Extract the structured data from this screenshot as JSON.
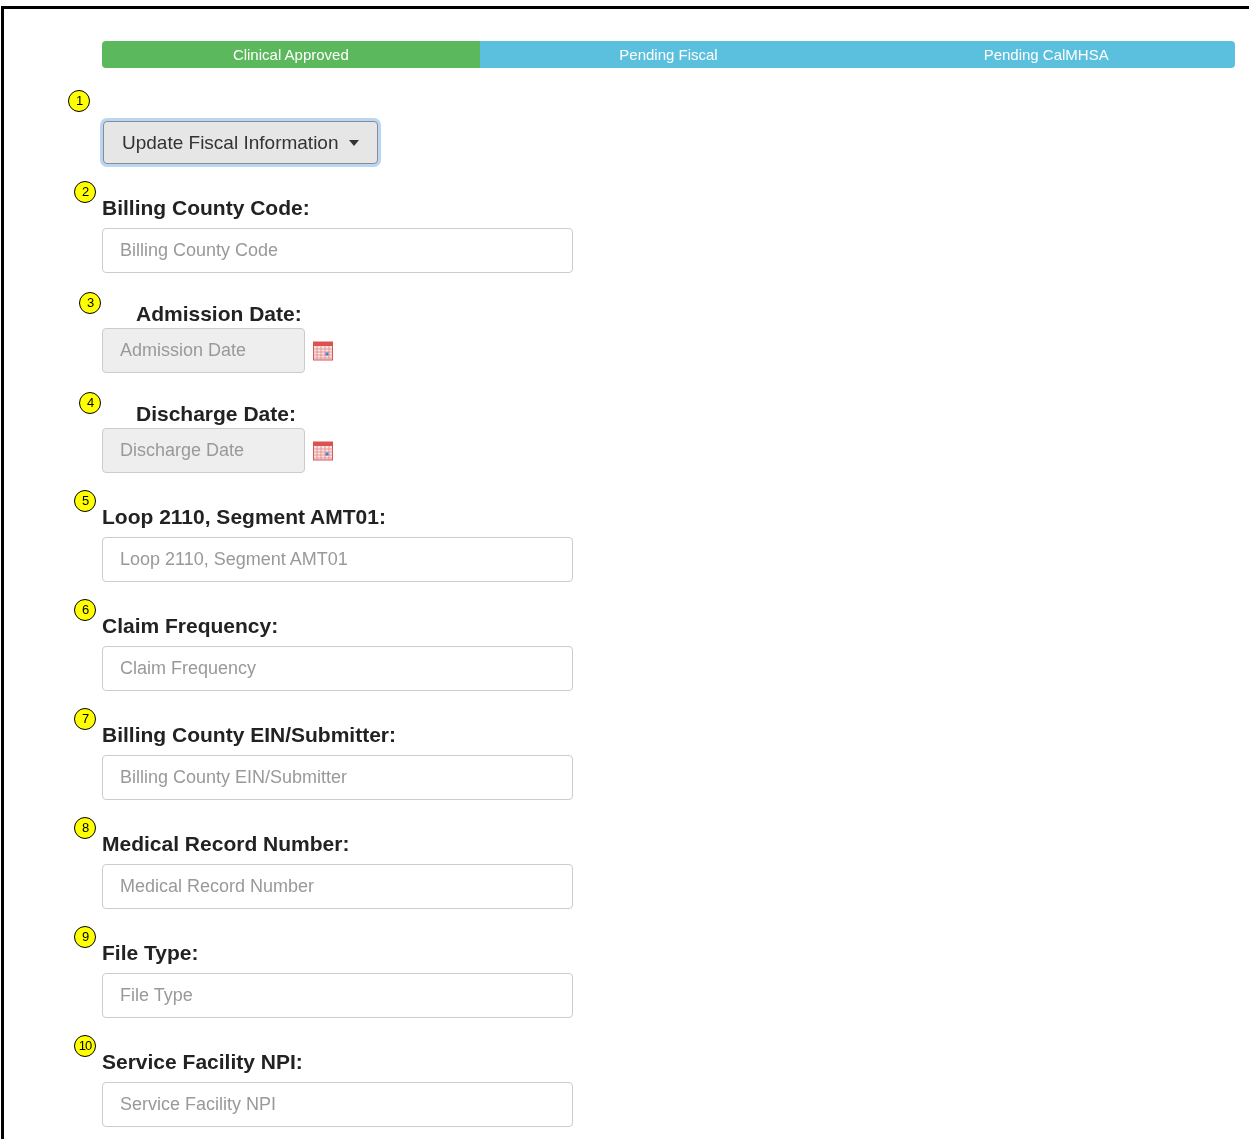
{
  "status_steps": [
    {
      "label": "Clinical Approved",
      "color": "#5cb85c"
    },
    {
      "label": "Pending Fiscal",
      "color": "#5bc0de"
    },
    {
      "label": "Pending CalMHSA",
      "color": "#5bc0de"
    }
  ],
  "update_button": {
    "callout": "1",
    "label": "Update Fiscal Information"
  },
  "fields": [
    {
      "callout": "2",
      "kind": "text",
      "label": "Billing County Code:",
      "placeholder": "Billing County Code"
    },
    {
      "callout": "3",
      "kind": "date",
      "label": "Admission Date:",
      "placeholder": "Admission Date"
    },
    {
      "callout": "4",
      "kind": "date",
      "label": "Discharge Date:",
      "placeholder": "Discharge Date"
    },
    {
      "callout": "5",
      "kind": "text",
      "label": "Loop 2110, Segment AMT01:",
      "placeholder": "Loop 2110, Segment AMT01"
    },
    {
      "callout": "6",
      "kind": "text",
      "label": "Claim Frequency:",
      "placeholder": "Claim Frequency"
    },
    {
      "callout": "7",
      "kind": "text",
      "label": "Billing County EIN/Submitter:",
      "placeholder": "Billing County EIN/Submitter"
    },
    {
      "callout": "8",
      "kind": "text",
      "label": "Medical Record Number:",
      "placeholder": "Medical Record Number"
    },
    {
      "callout": "9",
      "kind": "text",
      "label": "File Type:",
      "placeholder": "File Type"
    },
    {
      "callout": "10",
      "kind": "text",
      "label": "Service Facility NPI:",
      "placeholder": "Service Facility NPI"
    }
  ]
}
